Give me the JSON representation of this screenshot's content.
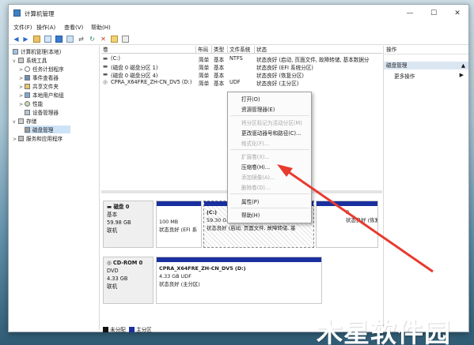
{
  "window": {
    "title": "计算机管理",
    "controls": {
      "minimize": "—",
      "maximize": "☐",
      "close": "✕"
    }
  },
  "menubar": {
    "items": [
      "文件(F)",
      "操作(A)",
      "查看(V)",
      "帮助(H)"
    ]
  },
  "toolbar": {
    "icons": [
      "back-icon",
      "forward-icon",
      "up-folder-icon",
      "properties-icon",
      "help-icon",
      "console-icon",
      "connect-icon",
      "refresh-icon",
      "delete-icon",
      "new-icon",
      "view-icon"
    ]
  },
  "tree": {
    "items": [
      {
        "label": "计算机管理(本地)",
        "icon": "computer-management-icon"
      },
      {
        "label": "系统工具",
        "icon": "tools-icon"
      },
      {
        "label": "任务计划程序",
        "icon": "clock-icon"
      },
      {
        "label": "事件查看器",
        "icon": "event-viewer-icon"
      },
      {
        "label": "共享文件夹",
        "icon": "shared-folder-icon"
      },
      {
        "label": "本地用户和组",
        "icon": "users-icon"
      },
      {
        "label": "性能",
        "icon": "performance-icon"
      },
      {
        "label": "设备管理器",
        "icon": "device-manager-icon"
      },
      {
        "label": "存储",
        "icon": "storage-icon"
      },
      {
        "label": "磁盘管理",
        "icon": "disk-management-icon"
      },
      {
        "label": "服务和应用程序",
        "icon": "services-icon"
      }
    ]
  },
  "volumes": {
    "headers": [
      "卷",
      "布局",
      "类型",
      "文件系统",
      "状态"
    ],
    "rows": [
      {
        "vol": "(C:)",
        "layout": "简单",
        "type": "基本",
        "fs": "NTFS",
        "status": "状态良好 (启动, 页面文件, 故障转储, 基本数据分"
      },
      {
        "vol": "(磁盘 0 磁盘分区 1)",
        "layout": "简单",
        "type": "基本",
        "fs": "",
        "status": "状态良好 (EFI 系统分区)"
      },
      {
        "vol": "(磁盘 0 磁盘分区 4)",
        "layout": "简单",
        "type": "基本",
        "fs": "",
        "status": "状态良好 (恢复分区)"
      },
      {
        "vol": "CPRA_X64FRE_ZH-CN_DV5 (D:)",
        "layout": "简单",
        "type": "基本",
        "fs": "UDF",
        "status": "状态良好 (主分区)"
      }
    ]
  },
  "disks": [
    {
      "name": "磁盘 0",
      "kind": "基本",
      "size": "59.98 GB",
      "state": "联机",
      "partitions": [
        {
          "line1": "100 MB",
          "line2": "状态良好 (EFI 系"
        },
        {
          "line1": "(C:)",
          "line2": "59.30 G",
          "line3": "状态良好 (启动, 页面文件, 故障转储, 基"
        },
        {
          "line1": "",
          "line2": "B",
          "line3": "状态良好 (恢复分区)"
        }
      ]
    },
    {
      "name": "CD-ROM 0",
      "kind": "DVD",
      "size": "4.33 GB",
      "state": "联机",
      "partitions": [
        {
          "line1": "CPRA_X64FRE_ZH-CN_DV5  (D:)",
          "line2": "4.33 GB UDF",
          "line3": "状态良好 (主分区)"
        }
      ]
    }
  ],
  "legend": {
    "unallocated": "未分配",
    "primary": "主分区"
  },
  "actions": {
    "header": "操作",
    "selected": "磁盘管理",
    "more": "更多操作"
  },
  "context_menu": {
    "items": [
      {
        "label": "打开(O)",
        "enabled": true
      },
      {
        "label": "资源管理器(E)",
        "enabled": true
      },
      {
        "label": "将分区标记为活动分区(M)",
        "enabled": false
      },
      {
        "label": "更改驱动器号和路径(C)...",
        "enabled": true
      },
      {
        "label": "格式化(F)...",
        "enabled": false
      },
      {
        "label": "扩展卷(X)...",
        "enabled": false
      },
      {
        "label": "压缩卷(H)...",
        "enabled": true
      },
      {
        "label": "添加镜像(A)...",
        "enabled": false
      },
      {
        "label": "删除卷(D)...",
        "enabled": false
      },
      {
        "label": "属性(P)",
        "enabled": true
      },
      {
        "label": "帮助(H)",
        "enabled": true
      }
    ]
  },
  "watermark": {
    "text": "木星软件园"
  },
  "colors": {
    "primary_partition": "#1a2fa0",
    "unallocated": "#111111",
    "selection": "#cde3f7",
    "arrow": "#e83a2f"
  }
}
